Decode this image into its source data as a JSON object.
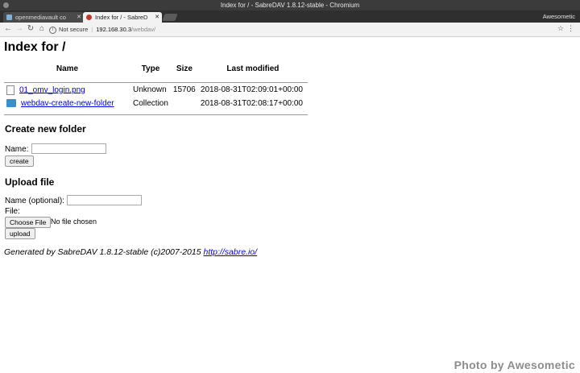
{
  "window": {
    "title": "Index for / - SabreDAV 1.8.12-stable - Chromium",
    "profile": "Awesometic"
  },
  "tabs": [
    {
      "label": "openmediavault co"
    },
    {
      "label": "Index for / - SabreD"
    }
  ],
  "address_bar": {
    "security": "Not secure",
    "host": "192.168.30.3",
    "path": "/webdav/"
  },
  "page": {
    "heading": "Index for /",
    "columns": [
      "Name",
      "Type",
      "Size",
      "Last modified"
    ],
    "rows": [
      {
        "icon": "file-icon",
        "name": "01_omv_login.png",
        "type": "Unknown",
        "size": "15706",
        "modified": "2018-08-31T02:09:01+00:00"
      },
      {
        "icon": "folder-icon",
        "name": "webdav-create-new-folder",
        "type": "Collection",
        "size": "",
        "modified": "2018-08-31T02:08:17+00:00"
      }
    ],
    "create_folder": {
      "heading": "Create new folder",
      "name_label": "Name:",
      "name_value": "",
      "button": "create"
    },
    "upload": {
      "heading": "Upload file",
      "name_label": "Name (optional):",
      "name_value": "",
      "file_label": "File:",
      "choose_button": "Choose File",
      "no_file": "No file chosen",
      "button": "upload"
    },
    "footer": {
      "text": "Generated by SabreDAV 1.8.12-stable (c)2007-2015 ",
      "link": "http://sabre.io/"
    }
  },
  "watermark": "Photo by Awesometic"
}
